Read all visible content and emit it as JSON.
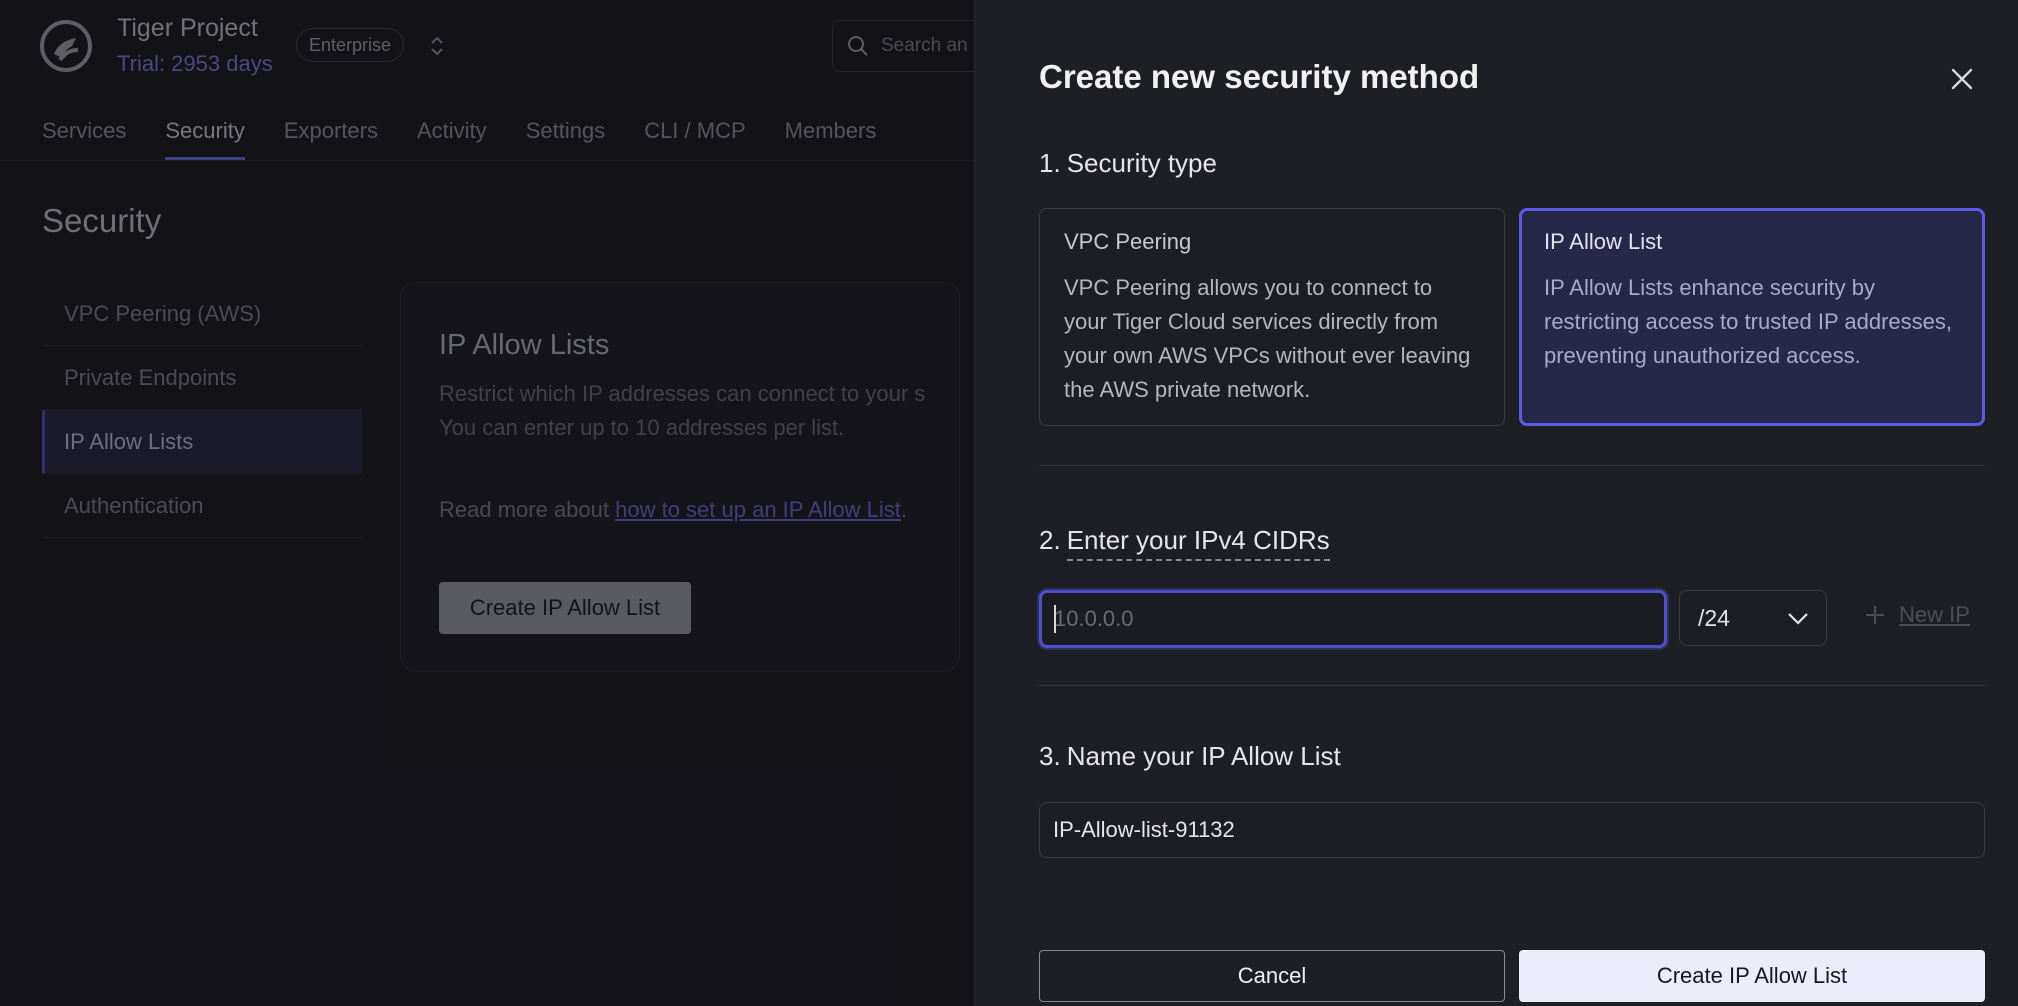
{
  "header": {
    "project_name": "Tiger Project",
    "trial": "Trial: 2953 days",
    "plan_badge": "Enterprise",
    "search_placeholder": "Search an"
  },
  "tabs": [
    {
      "label": "Services"
    },
    {
      "label": "Security",
      "active": true
    },
    {
      "label": "Exporters"
    },
    {
      "label": "Activity"
    },
    {
      "label": "Settings"
    },
    {
      "label": "CLI / MCP"
    },
    {
      "label": "Members"
    }
  ],
  "page": {
    "title": "Security",
    "side_menu": [
      {
        "label": "VPC Peering (AWS)"
      },
      {
        "label": "Private Endpoints"
      },
      {
        "label": "IP Allow Lists",
        "active": true
      },
      {
        "label": "Authentication"
      }
    ],
    "card": {
      "title": "IP Allow Lists",
      "description": "Restrict which IP addresses can connect to your s\nYou can enter up to 10 addresses per list.",
      "read_more_prefix": "Read more about ",
      "read_more_link": "how to set up an IP Allow List",
      "read_more_suffix": ".",
      "button": "Create IP Allow List"
    }
  },
  "drawer": {
    "title": "Create new security method",
    "section1": {
      "number": "1.",
      "label": "Security type"
    },
    "types": [
      {
        "title": "VPC Peering",
        "description": "VPC Peering allows you to connect to your Tiger Cloud services directly from your own AWS VPCs without ever leaving the AWS private network.",
        "selected": false
      },
      {
        "title": "IP Allow List",
        "description": "IP Allow Lists enhance security by restricting access to trusted IP addresses, preventing unauthorized access.",
        "selected": true
      }
    ],
    "section2": {
      "number": "2.",
      "label": "Enter your IPv4 CIDRs"
    },
    "ip_input": {
      "placeholder": "10.0.0.0",
      "value": ""
    },
    "mask_select": {
      "value": "/24"
    },
    "new_ip": "New IP",
    "section3": {
      "number": "3.",
      "label": "Name your IP Allow List"
    },
    "name_input": {
      "value": "IP-Allow-list-91132"
    },
    "cancel": "Cancel",
    "submit": "Create IP Allow List"
  },
  "colors": {
    "background": "#17171d",
    "drawer_bg": "#1e1e25",
    "accent": "#5c5ce6",
    "primary_button": "#ececfb"
  }
}
